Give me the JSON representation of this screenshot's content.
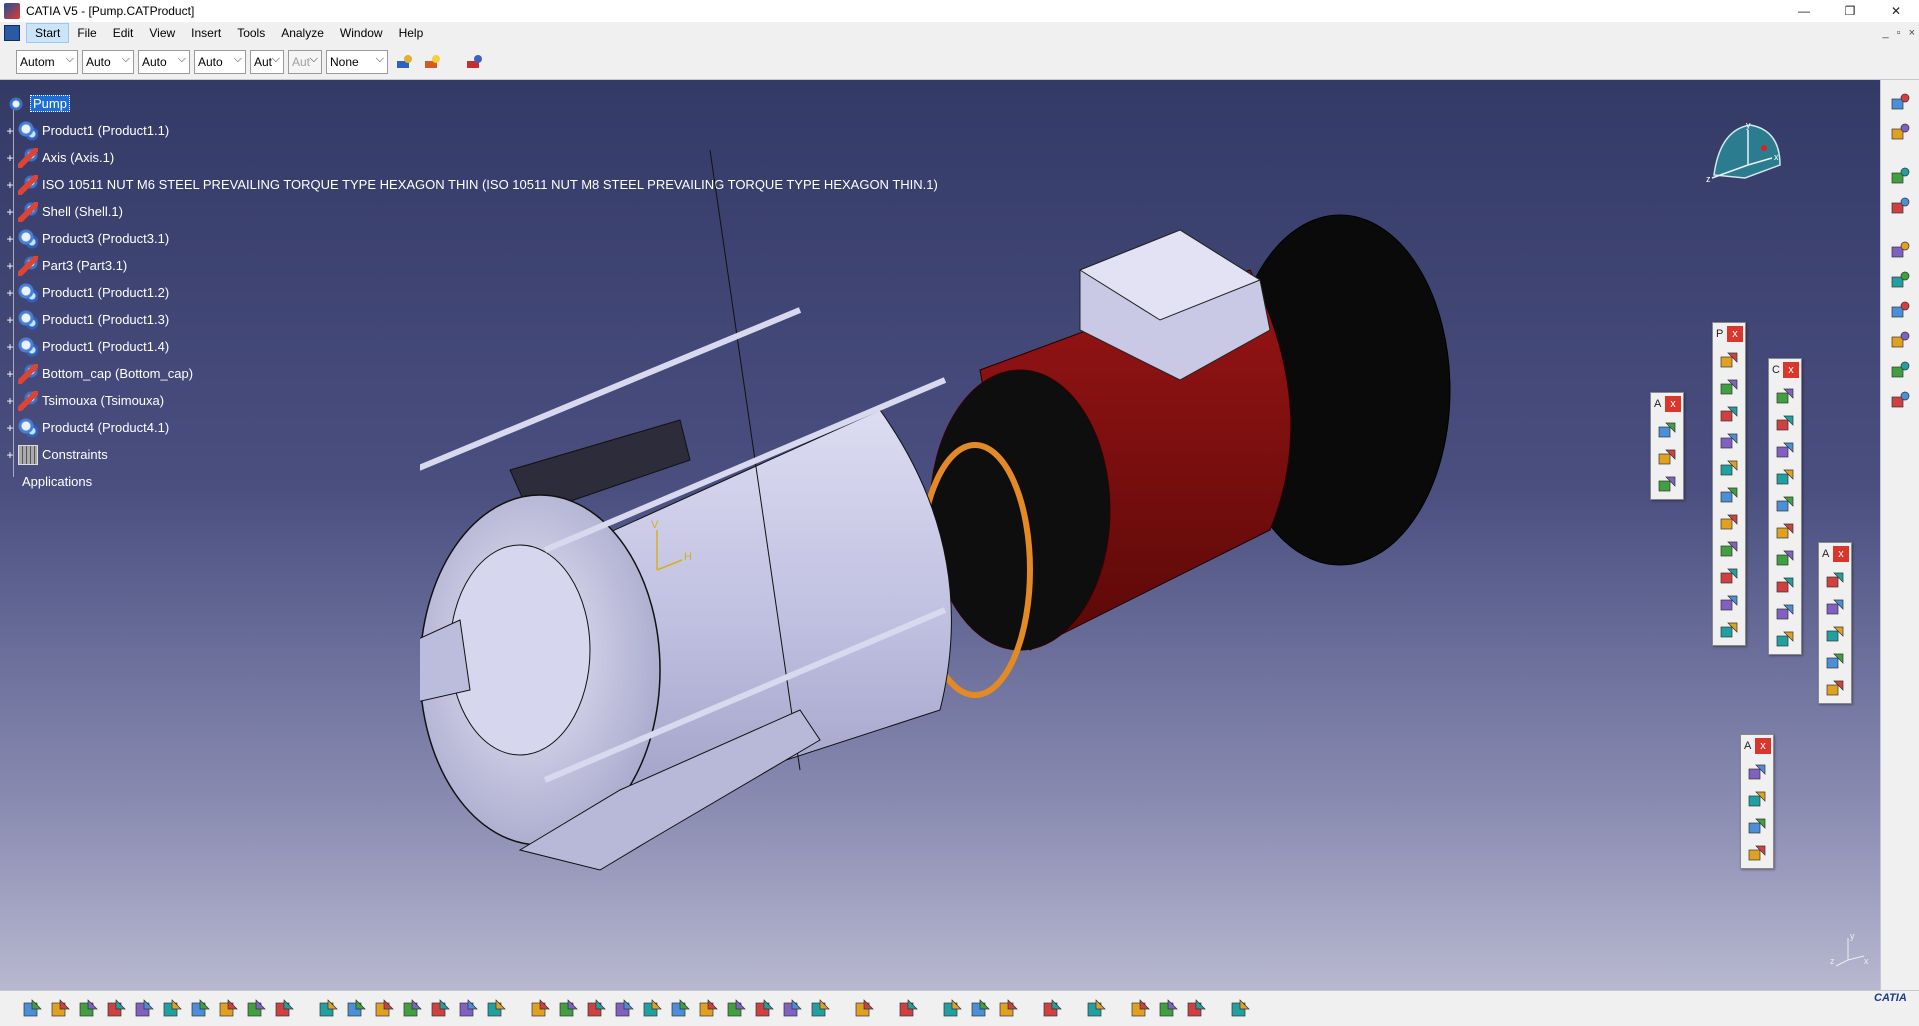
{
  "window": {
    "title": "CATIA V5 - [Pump.CATProduct]",
    "controls": {
      "minimize": "—",
      "restore": "❐",
      "close": "✕"
    }
  },
  "menu": {
    "items": [
      "Start",
      "File",
      "Edit",
      "View",
      "Insert",
      "Tools",
      "Analyze",
      "Window",
      "Help"
    ],
    "active_index": 0,
    "mdi": {
      "minimize": "_",
      "restore": "▫",
      "close": "×"
    }
  },
  "toolbar_top": {
    "combos": [
      {
        "value": "Autom",
        "width": 62
      },
      {
        "value": "Auto",
        "width": 52
      },
      {
        "value": "Auto",
        "width": 52
      },
      {
        "value": "Auto",
        "width": 52
      },
      {
        "value": "Aut",
        "width": 34
      },
      {
        "value": "Aut",
        "width": 34,
        "disabled": true
      },
      {
        "value": "None",
        "width": 62
      }
    ]
  },
  "tree": {
    "root": "Pump",
    "nodes": [
      {
        "label": "Product1 (Product1.1)",
        "icon": "product"
      },
      {
        "label": "Axis (Axis.1)",
        "icon": "part"
      },
      {
        "label": "ISO 10511 NUT M6 STEEL PREVAILING TORQUE TYPE HEXAGON THIN (ISO 10511 NUT M8 STEEL PREVAILING TORQUE TYPE HEXAGON THIN.1)",
        "icon": "part"
      },
      {
        "label": "Shell (Shell.1)",
        "icon": "part"
      },
      {
        "label": "Product3 (Product3.1)",
        "icon": "product"
      },
      {
        "label": "Part3 (Part3.1)",
        "icon": "part"
      },
      {
        "label": "Product1 (Product1.2)",
        "icon": "product"
      },
      {
        "label": "Product1 (Product1.3)",
        "icon": "product"
      },
      {
        "label": "Product1 (Product1.4)",
        "icon": "product"
      },
      {
        "label": "Bottom_cap (Bottom_cap)",
        "icon": "part"
      },
      {
        "label": "Tsimouxa (Tsimouxa)",
        "icon": "part"
      },
      {
        "label": "Product4 (Product4.1)",
        "icon": "product"
      },
      {
        "label": "Constraints",
        "icon": "constraints"
      }
    ],
    "applications": "Applications"
  },
  "compass": {
    "x": "x",
    "y": "y",
    "z": "z"
  },
  "model_axis": {
    "v": "V",
    "h": "H"
  },
  "corner_axis": {
    "x": "x",
    "y": "y",
    "z": "z"
  },
  "floating_toolbars": [
    {
      "title": "A",
      "close": "x",
      "buttons": 3
    },
    {
      "title": "P",
      "close": "x",
      "buttons": 11
    },
    {
      "title": "C",
      "close": "x",
      "buttons": 10
    },
    {
      "title": "A",
      "close": "x",
      "buttons": 5
    },
    {
      "title": "A",
      "close": "x",
      "buttons": 4
    }
  ],
  "brand": {
    "logo": "CATIA"
  },
  "colors": {
    "viewport_top": "#343a66",
    "viewport_bottom": "#b8b8d0",
    "motor_red": "#7a1010",
    "body_lavender": "#c8c8e8",
    "selection": "#1e6cd6"
  }
}
